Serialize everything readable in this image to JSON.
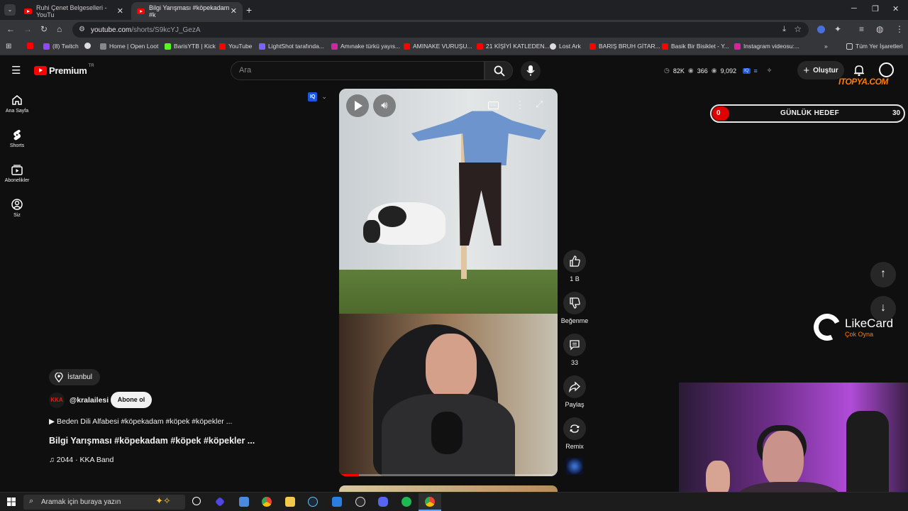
{
  "browser": {
    "tabs": [
      {
        "title": "Ruhi Çenet Belgeselleri - YouTu"
      },
      {
        "title": "Bilgi Yarışması #köpekadam #k"
      }
    ],
    "new_tab": "+",
    "url_host": "youtube.com",
    "url_path": "/shorts/S9kcYJ_GezA",
    "bookmarks": [
      "(8) Twitch",
      "Home | Open Loot",
      "BarisYTB | Kick",
      "YouTube",
      "LightShot tarafında...",
      "Amınake türkü yayıs...",
      "AMINAKE VURUŞU...",
      "21 KİŞİYİ KATLEDEN...",
      "Lost Ark",
      "BARIŞ BRUH GİTAR...",
      "Basik Bir Bisiklet - Y...",
      "Instagram videosu:..."
    ],
    "all_bookmarks": "Tüm Yer İşaretleri"
  },
  "youtube": {
    "logo": "Premium",
    "logo_sup": "TR",
    "search_placeholder": "Ara",
    "stats": {
      "views": "82K",
      "watching": "366",
      "count": "9,092"
    },
    "create_label": "Oluştur",
    "nav": [
      {
        "label": "Ana Sayfa",
        "icon": "home-icon"
      },
      {
        "label": "Shorts",
        "icon": "shorts-icon"
      },
      {
        "label": "Abonelikler",
        "icon": "subscriptions-icon"
      },
      {
        "label": "Siz",
        "icon": "account-icon"
      }
    ],
    "iq_badge": "IQ",
    "location": "İstanbul",
    "channel_badge": "KKA",
    "channel": "@kralailesi",
    "subscribe": "Abone ol",
    "playlist_line": "▶ Beden Dili Alfabesi #köpekadam #köpek #köpekler ...",
    "title": "Bilgi Yarışması #köpekadam #köpek #köpekler ...",
    "music": "♫ 2044 · KKA Band",
    "actions": {
      "like_count": "1 B",
      "dislike_label": "Beğenme",
      "comment_count": "33",
      "share_label": "Paylaş",
      "remix_label": "Remix"
    }
  },
  "overlay": {
    "goal_left": "0",
    "goal_title": "GÜNLÜK HEDEF",
    "goal_right": "30",
    "sponsor_watermark": "ITOPYA.COM",
    "likecard_name": "LikeCard",
    "likecard_tagline": "Çok Oyna",
    "accent": "#e00000",
    "yt_red": "#ff0000"
  },
  "taskbar": {
    "search_placeholder": "Aramak için buraya yazın"
  }
}
